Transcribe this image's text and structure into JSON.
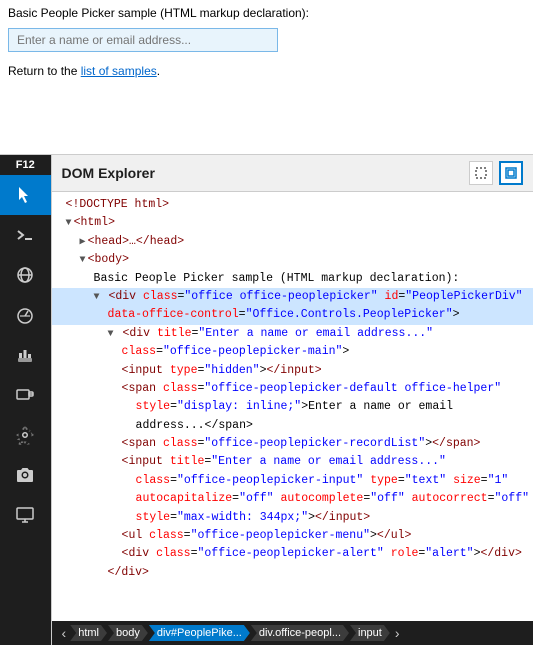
{
  "top": {
    "title": "Basic People Picker sample (HTML markup declaration):",
    "input_placeholder": "Enter a name or email address...",
    "return_text": "Return to the ",
    "link_text": "list of samples",
    "link_href": "#"
  },
  "sidebar": {
    "f12_label": "F12",
    "icons": [
      {
        "name": "pointer-icon",
        "label": "Pointer",
        "active": true
      },
      {
        "name": "console-icon",
        "label": "Console",
        "active": false
      },
      {
        "name": "network-icon",
        "label": "Network",
        "active": false
      },
      {
        "name": "performance-icon",
        "label": "Performance",
        "active": false
      },
      {
        "name": "memory-icon",
        "label": "Memory",
        "active": false
      },
      {
        "name": "emulation-icon",
        "label": "Emulation",
        "active": false
      },
      {
        "name": "settings-icon",
        "label": "Settings",
        "active": false
      },
      {
        "name": "camera-icon",
        "label": "Camera",
        "active": false
      },
      {
        "name": "screen-icon",
        "label": "Screen",
        "active": false
      }
    ]
  },
  "dom_explorer": {
    "title": "DOM Explorer",
    "header_icon1": "select-element-icon",
    "header_icon2": "box-model-icon",
    "tree": {
      "doctype": "<!DOCTYPE html>",
      "html_open": "<html>",
      "head": "<head>…</head>",
      "body_open": "<body>",
      "body_text": "Basic People Picker sample (HTML markup declaration):",
      "div_main": "div",
      "div_main_attrs": "class=\"office office-peoplepicker\" id=\"PeoplePickerDiv\"",
      "div_main_attr2": "data-office-control=\"Office.Controls.PeoplePicker\">",
      "div_inner": "div",
      "div_inner_attr": "title=\"Enter a name or email address...\"",
      "div_inner_class": "class=\"office-peoplepicker-main\">",
      "input_hidden": "<input type=\"hidden\"></input>",
      "span_default": "<span class=\"office-peoplepicker-default office-helper\"",
      "span_default2": "style=\"display: inline;\">Enter a name or email",
      "span_default3": "address...</span>",
      "span_record": "<span class=\"office-peoplepicker-recordList\"></span>",
      "input_title": "<input title=\"Enter a name or email address...\"",
      "input_class": "class=\"office-peoplepicker-input\" type=\"text\" size=\"1\"",
      "input_attrs": "autocapitalize=\"off\" autocomplete=\"off\" autocorrect=\"off\"",
      "input_style": "style=\"max-width: 344px;\"></input>",
      "ul_menu": "<ul class=\"office-peoplepicker-menu\"></ul>",
      "div_alert": "<div class=\"office-peoplepicker-alert\" role=\"alert\"></div>",
      "div_close": "</div>"
    }
  },
  "breadcrumb": {
    "items": [
      {
        "label": "html",
        "active": false
      },
      {
        "label": "body",
        "active": false
      },
      {
        "label": "div#PeoplePike...",
        "active": true
      },
      {
        "label": "div.office-peopl...",
        "active": false
      },
      {
        "label": "input",
        "active": false
      }
    ],
    "scroll_left": "‹",
    "scroll_right": "›"
  }
}
